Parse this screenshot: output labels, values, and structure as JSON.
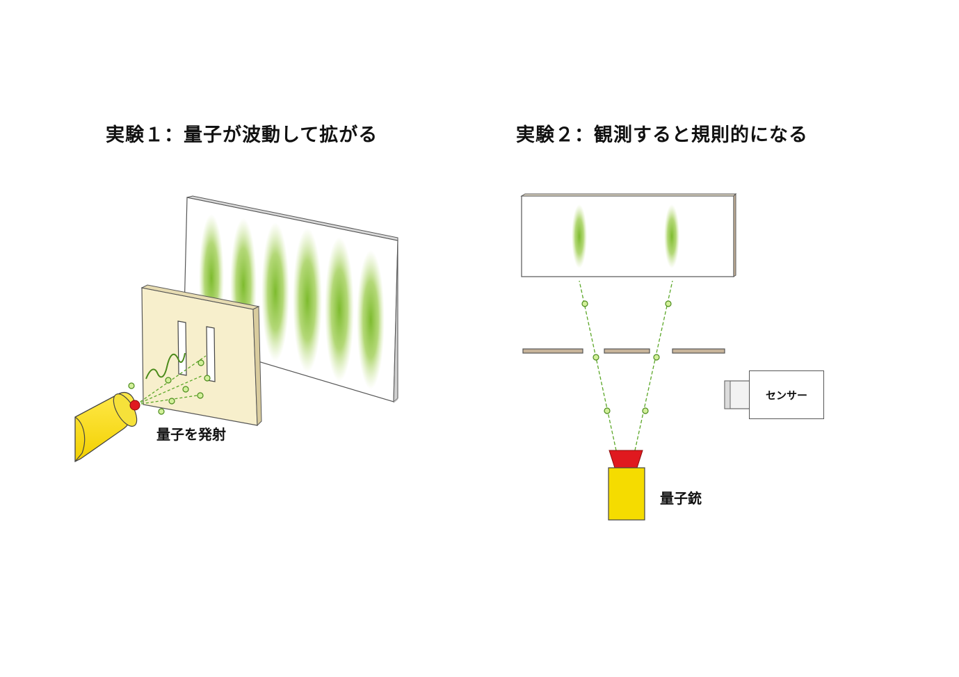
{
  "experiment1": {
    "title": "実験１：量子が波動して拡がる",
    "emit_label": "量子を発射",
    "colors": {
      "gun": "#f5dc00",
      "nozzle": "#e0191f",
      "slit_plate": "#f7efcc",
      "wave": "#8cc63f",
      "particle": "#c9ec8a"
    }
  },
  "experiment2": {
    "title": "実験２：観測すると規則的になる",
    "sensor_label": "センサー",
    "gun_label": "量子銃",
    "colors": {
      "gun": "#f5dc00",
      "nozzle": "#e0191f",
      "plate_edge": "#c8b49a",
      "wave": "#8cc63f",
      "particle": "#c9ec8a"
    }
  }
}
